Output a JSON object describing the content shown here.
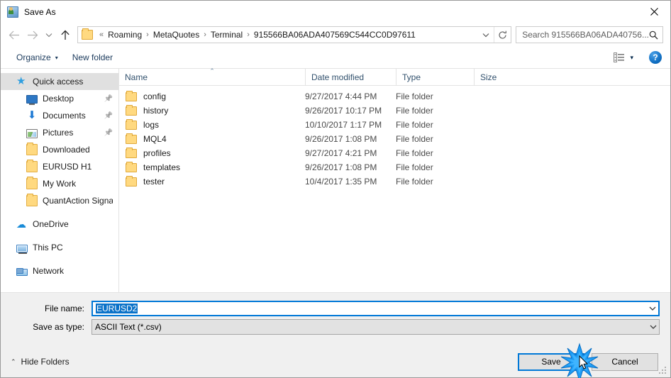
{
  "window": {
    "title": "Save As",
    "icon": "save-as-icon",
    "close_label": "✕"
  },
  "navbar": {
    "back_icon": "back-arrow-icon",
    "forward_icon": "forward-arrow-icon",
    "recent_icon": "recent-locations-chevron-icon",
    "up_icon": "up-arrow-icon",
    "folder_icon": "folder-icon",
    "breadcrumb_prefix": "«",
    "breadcrumbs": [
      "Roaming",
      "MetaQuotes",
      "Terminal",
      "915566BA06ADA407569C544CC0D97611"
    ],
    "separator": "›",
    "dropdown_icon": "chevron-down-icon",
    "refresh_icon": "refresh-icon"
  },
  "search": {
    "placeholder": "Search 915566BA06ADA40756...",
    "icon": "search-icon"
  },
  "toolbar": {
    "organize_label": "Organize",
    "organize_caret": "▾",
    "new_folder_label": "New folder",
    "view_icon": "view-layout-icon",
    "view_caret": "▾",
    "help_label": "?"
  },
  "sidebar": {
    "items": [
      {
        "label": "Quick access",
        "icon": "star-icon",
        "level": 0,
        "selected": true,
        "pinned": false
      },
      {
        "label": "Desktop",
        "icon": "desktop-icon",
        "level": 1,
        "selected": false,
        "pinned": true
      },
      {
        "label": "Documents",
        "icon": "documents-icon",
        "level": 1,
        "selected": false,
        "pinned": true
      },
      {
        "label": "Pictures",
        "icon": "pictures-icon",
        "level": 1,
        "selected": false,
        "pinned": true
      },
      {
        "label": "Downloaded",
        "icon": "folder-icon",
        "level": 1,
        "selected": false,
        "pinned": false
      },
      {
        "label": "EURUSD H1",
        "icon": "folder-icon",
        "level": 1,
        "selected": false,
        "pinned": false
      },
      {
        "label": "My Work",
        "icon": "folder-icon",
        "level": 1,
        "selected": false,
        "pinned": false
      },
      {
        "label": "QuantAction Signal",
        "icon": "folder-icon",
        "level": 1,
        "selected": false,
        "pinned": false
      },
      {
        "label": "OneDrive",
        "icon": "onedrive-icon",
        "level": 0,
        "selected": false,
        "pinned": false,
        "group": true
      },
      {
        "label": "This PC",
        "icon": "this-pc-icon",
        "level": 0,
        "selected": false,
        "pinned": false,
        "group": true
      },
      {
        "label": "Network",
        "icon": "network-icon",
        "level": 0,
        "selected": false,
        "pinned": false,
        "group": true
      }
    ]
  },
  "filelist": {
    "columns": [
      "Name",
      "Date modified",
      "Type",
      "Size"
    ],
    "sort_column": "Name",
    "sort_direction": "ascending",
    "sort_caret": "⌃",
    "rows": [
      {
        "name": "config",
        "date": "9/27/2017 4:44 PM",
        "type": "File folder",
        "size": ""
      },
      {
        "name": "history",
        "date": "9/26/2017 10:17 PM",
        "type": "File folder",
        "size": ""
      },
      {
        "name": "logs",
        "date": "10/10/2017 1:17 PM",
        "type": "File folder",
        "size": ""
      },
      {
        "name": "MQL4",
        "date": "9/26/2017 1:08 PM",
        "type": "File folder",
        "size": ""
      },
      {
        "name": "profiles",
        "date": "9/27/2017 4:21 PM",
        "type": "File folder",
        "size": ""
      },
      {
        "name": "templates",
        "date": "9/26/2017 1:08 PM",
        "type": "File folder",
        "size": ""
      },
      {
        "name": "tester",
        "date": "10/4/2017 1:35 PM",
        "type": "File folder",
        "size": ""
      }
    ]
  },
  "fields": {
    "filename_label": "File name:",
    "filename_value": "EURUSD2",
    "filename_selected": true,
    "savetype_label": "Save as type:",
    "savetype_value": "ASCII Text (*.csv)",
    "dropdown_icon": "chevron-down-icon"
  },
  "actions": {
    "hide_folders_label": "Hide Folders",
    "hide_folders_caret": "⌃",
    "save_label": "Save",
    "cancel_label": "Cancel",
    "resize_grip": "resize-grip-icon"
  },
  "colors": {
    "accent": "#0078d7",
    "selection": "#0a72c8",
    "folder": "#ffd980",
    "chrome": "#f0f0f0",
    "link_text": "#1b3a5c"
  }
}
